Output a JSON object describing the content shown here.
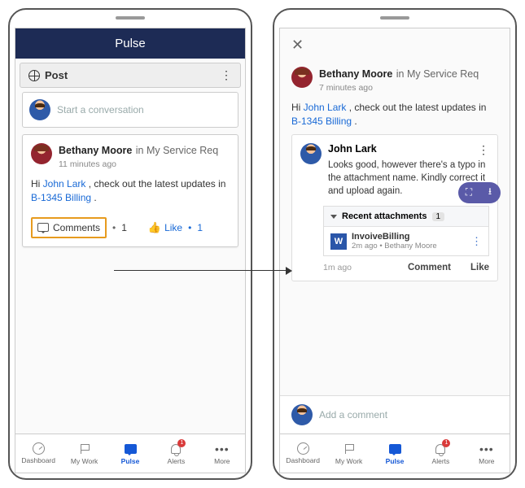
{
  "left": {
    "title": "Pulse",
    "postHeader": "Post",
    "composePlaceholder": "Start a conversation",
    "feed": {
      "author": "Bethany Moore",
      "context": "in My Service Req",
      "time": "11 minutes ago",
      "greeting": "Hi ",
      "mention": "John Lark",
      "mid": " , check out the latest updates in ",
      "caseLink": "B-1345 Billing",
      "tail": " .",
      "commentsLabel": "Comments",
      "commentsCount": "1",
      "likeLabel": "Like",
      "likeCount": "1"
    }
  },
  "right": {
    "author": "Bethany Moore",
    "context": "in My Service Req",
    "time": "7 minutes ago",
    "greeting": "Hi ",
    "mention": "John Lark",
    "mid": " , check out the latest updates in ",
    "caseLink": "B-1345 Billing",
    "tail": " .",
    "reply": {
      "author": "John Lark",
      "body": "Looks good, however there's a typo in the attachment name. Kindly correct it and upload again.",
      "time": "1m ago",
      "commentLabel": "Comment",
      "likeLabel": "Like"
    },
    "attachments": {
      "heading": "Recent attachments",
      "count": "1",
      "item": {
        "icon": "W",
        "name": "InvoiveBilling",
        "meta": "2m ago  •  Bethany Moore"
      }
    },
    "addCommentPlaceholder": "Add a comment"
  },
  "tabs": {
    "dashboard": "Dashboard",
    "mywork": "My Work",
    "pulse": "Pulse",
    "alerts": "Alerts",
    "alertBadge": "1",
    "more": "More"
  }
}
